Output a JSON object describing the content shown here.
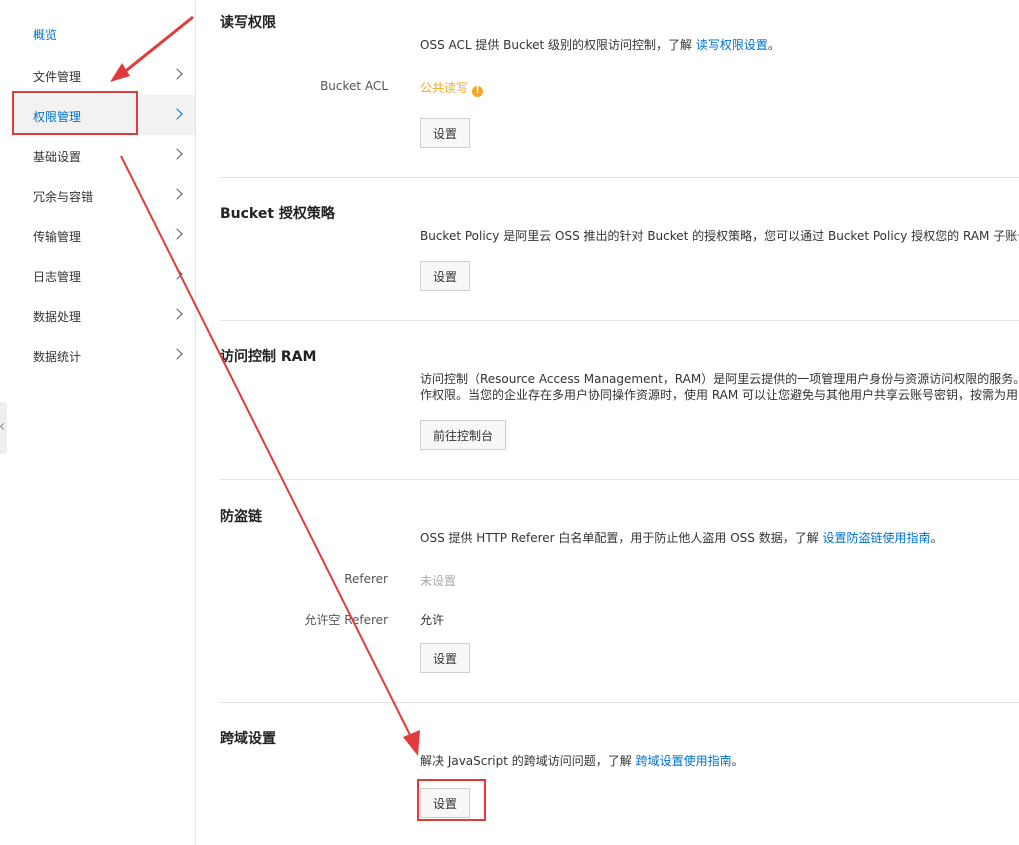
{
  "sidebar": {
    "items": [
      {
        "label": "概览"
      },
      {
        "label": "文件管理"
      },
      {
        "label": "权限管理"
      },
      {
        "label": "基础设置"
      },
      {
        "label": "冗余与容错"
      },
      {
        "label": "传输管理"
      },
      {
        "label": "日志管理"
      },
      {
        "label": "数据处理"
      },
      {
        "label": "数据统计"
      }
    ]
  },
  "sections": {
    "acl": {
      "title": "读写权限",
      "desc_prefix": "OSS ACL 提供 Bucket 级别的权限访问控制，了解 ",
      "desc_link": "读写权限设置",
      "desc_suffix": "。",
      "field_label": "Bucket ACL",
      "field_value": "公共读写",
      "warn_icon": "!",
      "button": "设置"
    },
    "policy": {
      "title": "Bucket 授权策略",
      "desc": "Bucket Policy 是阿里云 OSS 推出的针对 Bucket 的授权策略，您可以通过 Bucket Policy 授权您的 RAM 子账号",
      "button": "设置"
    },
    "ram": {
      "title": "访问控制 RAM",
      "desc_line1": "访问控制（Resource Access Management，RAM）是阿里云提供的一项管理用户身份与资源访问权限的服务。",
      "desc_line2": "作权限。当您的企业存在多用户协同操作资源时，使用 RAM 可以让您避免与其他用户共享云账号密钥，按需为用",
      "button": "前往控制台"
    },
    "referer": {
      "title": "防盗链",
      "desc_prefix": "OSS 提供 HTTP Referer 白名单配置，用于防止他人盗用 OSS 数据，了解 ",
      "desc_link": "设置防盗链使用指南",
      "desc_suffix": "。",
      "referer_label": "Referer",
      "referer_value": "未设置",
      "allow_empty_label": "允许空 Referer",
      "allow_empty_value": "允许",
      "button": "设置"
    },
    "cors": {
      "title": "跨域设置",
      "desc_prefix": "解决 JavaScript 的跨域访问问题，了解 ",
      "desc_link": "跨域设置使用指南",
      "desc_suffix": "。",
      "button": "设置"
    }
  },
  "colors": {
    "accent": "#0070cc",
    "warning": "#f5a623",
    "annotation": "#e23b3b"
  }
}
